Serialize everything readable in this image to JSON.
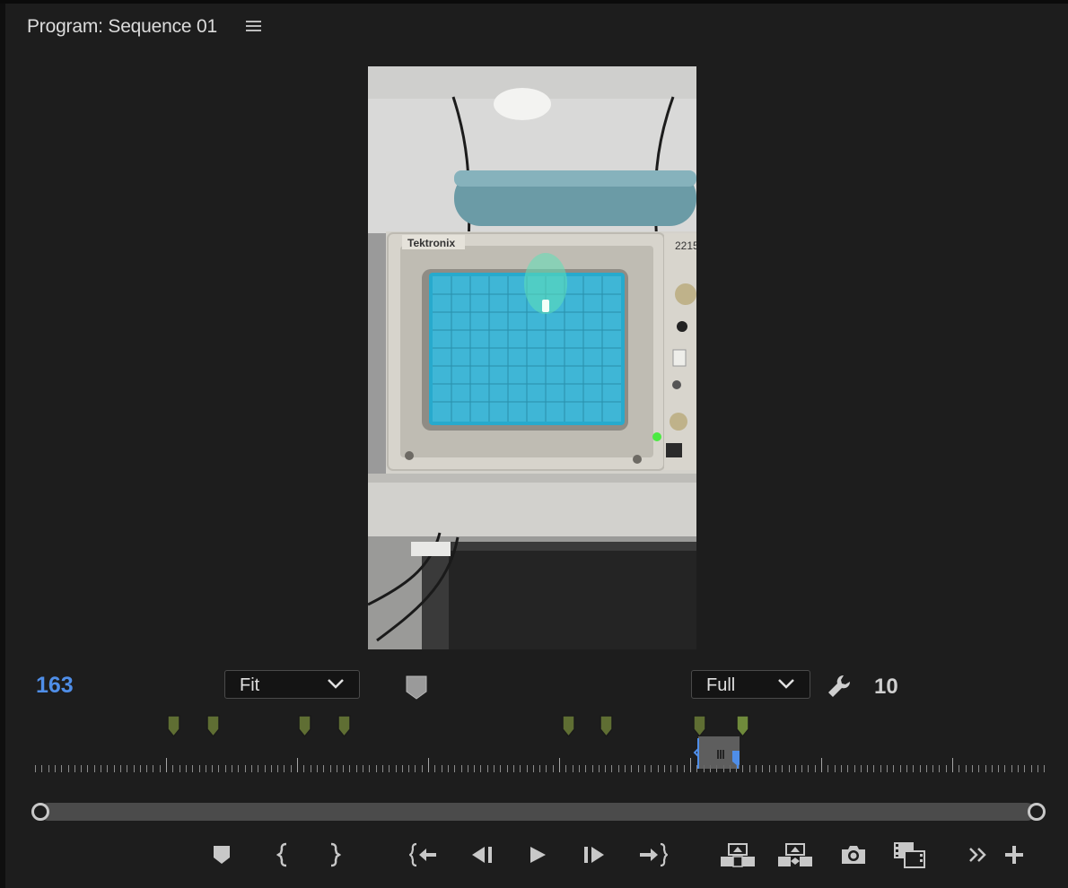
{
  "panel": {
    "title": "Program: Sequence 01",
    "menu_icon": "hamburger-menu-icon"
  },
  "video": {
    "description_icon": "video-frame",
    "brand_text": "Tektronix",
    "model_text": "2215",
    "screen_color": "#3fb6d6"
  },
  "controls": {
    "timecode": "163",
    "zoom": {
      "selected": "Fit"
    },
    "resolution": {
      "selected": "Full"
    },
    "quality_value": "10",
    "accent_color": "#4f8ee8",
    "marker_color": "#5f6e33"
  },
  "transport": {
    "buttons": [
      {
        "name": "add-marker-button",
        "icon": "marker-icon"
      },
      {
        "name": "mark-in-button",
        "icon": "mark-in-icon"
      },
      {
        "name": "mark-out-button",
        "icon": "mark-out-icon"
      },
      {
        "name": "go-to-in-button",
        "icon": "go-to-in-icon"
      },
      {
        "name": "step-back-button",
        "icon": "step-back-icon"
      },
      {
        "name": "play-button",
        "icon": "play-icon"
      },
      {
        "name": "step-forward-button",
        "icon": "step-forward-icon"
      },
      {
        "name": "go-to-out-button",
        "icon": "go-to-out-icon"
      },
      {
        "name": "lift-button",
        "icon": "lift-icon"
      },
      {
        "name": "extract-button",
        "icon": "extract-icon"
      },
      {
        "name": "export-frame-button",
        "icon": "camera-icon"
      },
      {
        "name": "comparison-view-button",
        "icon": "comparison-view-icon"
      },
      {
        "name": "more-button",
        "icon": "double-chevron-right-icon"
      },
      {
        "name": "button-editor-button",
        "icon": "plus-icon"
      }
    ]
  }
}
